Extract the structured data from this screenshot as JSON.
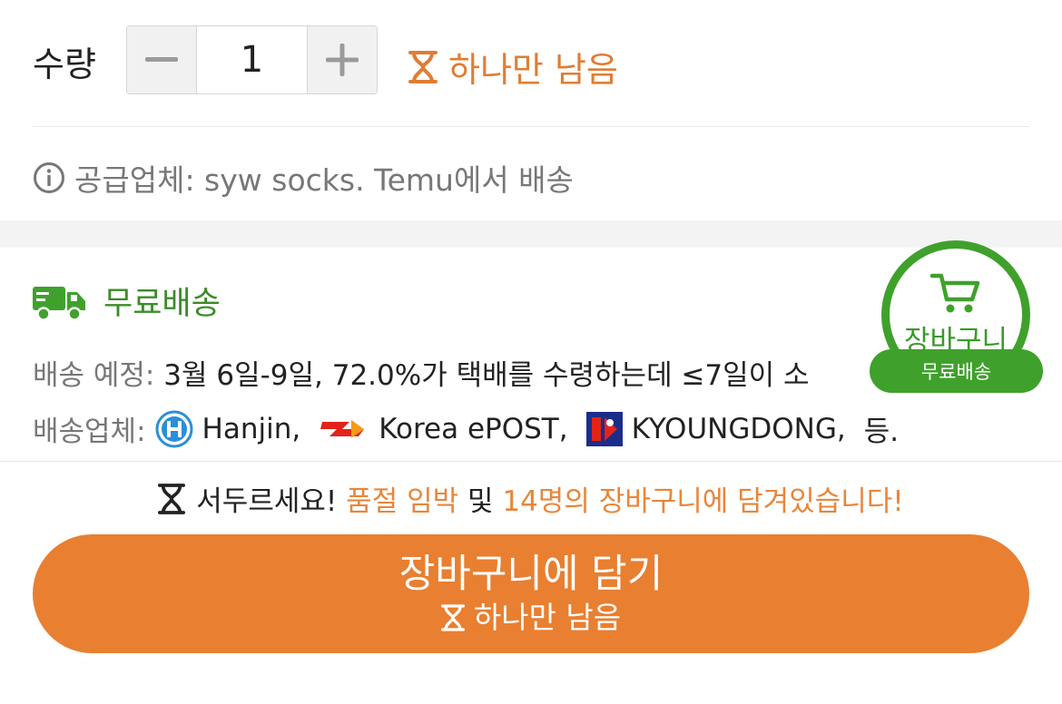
{
  "quantity": {
    "label": "수량",
    "value": "1",
    "stock_warning": "하나만 남음"
  },
  "supplier": {
    "text": "공급업체: syw socks. Temu에서 배송"
  },
  "shipping": {
    "title": "무료배송",
    "eta_label": "배송 예정:",
    "eta_value": "3월 6일-9일, 72.0%가 택배를 수령하는데 ≤7일이 소",
    "carriers_label": "배송업체:",
    "carriers": [
      {
        "name": "Hanjin,",
        "icon": "hanjin-logo"
      },
      {
        "name": "Korea ePOST,",
        "icon": "korea-epost-logo"
      },
      {
        "name": "KYOUNGDONG,",
        "icon": "kyoungdong-logo"
      }
    ],
    "carriers_suffix": "등."
  },
  "cart_fab": {
    "label": "장바구니",
    "badge": "무료배송"
  },
  "hurry": {
    "prefix": "서두르세요!",
    "sold_out": "품절 임박",
    "conj": "및",
    "count_msg": "14명의 장바구니에 담겨있습니다!"
  },
  "add_to_cart": {
    "label": "장바구니에 담기",
    "sub": "하나만 남음"
  },
  "colors": {
    "orange": "#e97f30",
    "green": "#3fa12c",
    "warning": "#e07d34"
  }
}
